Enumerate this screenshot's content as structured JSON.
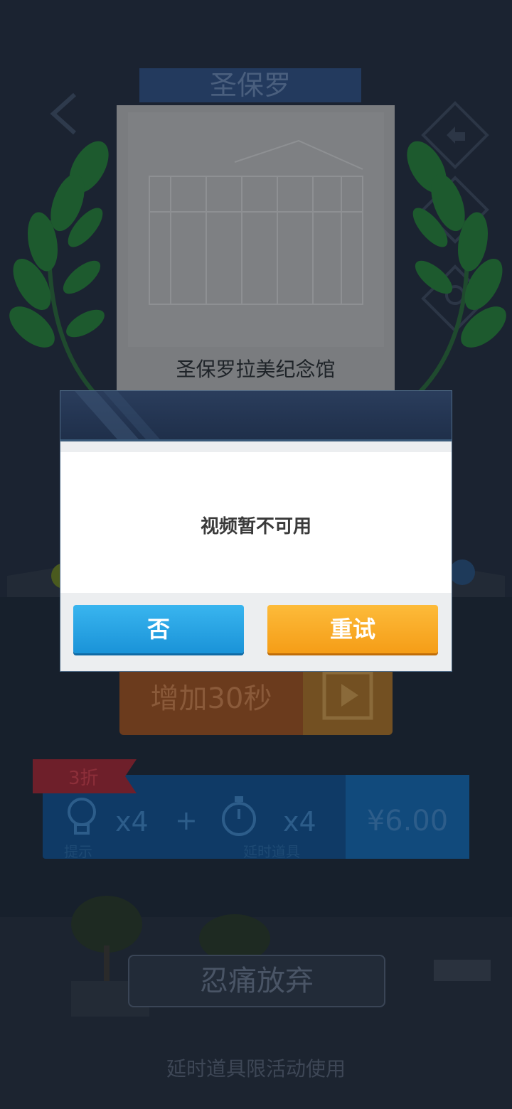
{
  "background": {
    "city_title": "圣保罗",
    "landmark_name": "圣保罗拉美纪念馆",
    "add_time_label": "增加30秒",
    "discount_tag": "3折",
    "bundle": {
      "item1_count": "x4",
      "item1_name": "提示",
      "plus": "+",
      "item2_count": "x4",
      "item2_name": "延时道具",
      "price": "¥6.00"
    },
    "give_up_label": "忍痛放弃",
    "footer_note": "延时道具限活动使用"
  },
  "dialog": {
    "message": "视频暂不可用",
    "no_label": "否",
    "retry_label": "重试"
  },
  "colors": {
    "dialog_no": "#1a93d8",
    "dialog_retry": "#f59d17",
    "dialog_header": "#1f2f4a"
  }
}
